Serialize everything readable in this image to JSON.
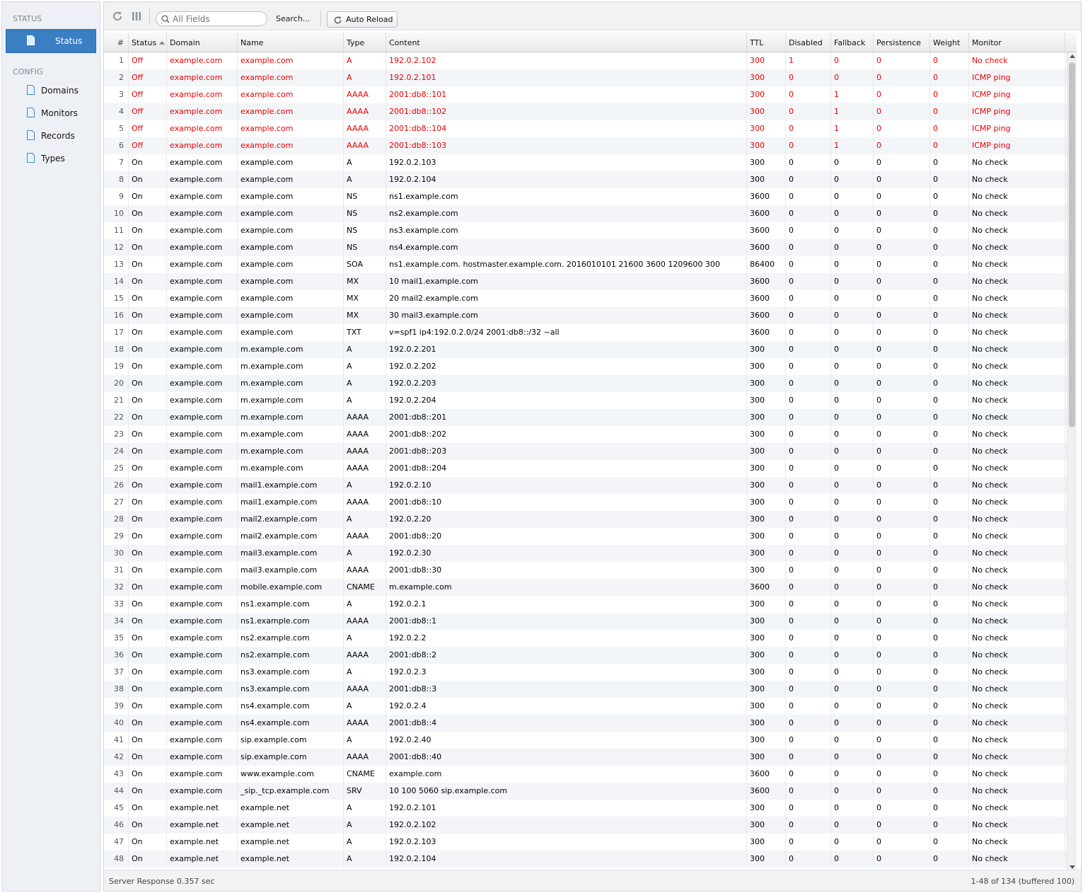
{
  "sidebar": {
    "status_section": "STATUS",
    "status_item": "Status",
    "config_section": "CONFIG",
    "config_items": [
      {
        "label": "Domains"
      },
      {
        "label": "Monitors"
      },
      {
        "label": "Records"
      },
      {
        "label": "Types"
      }
    ]
  },
  "toolbar": {
    "search_placeholder": "All Fields",
    "search_button": "Search...",
    "auto_reload": "Auto Reload"
  },
  "grid": {
    "columns": [
      "#",
      "Status",
      "Domain",
      "Name",
      "Type",
      "Content",
      "TTL",
      "Disabled",
      "Fallback",
      "Persistence",
      "Weight",
      "Monitor"
    ],
    "rows": [
      [
        "1",
        "Off",
        "example.com",
        "example.com",
        "A",
        "192.0.2.102",
        "300",
        "1",
        "0",
        "0",
        "0",
        "No check"
      ],
      [
        "2",
        "Off",
        "example.com",
        "example.com",
        "A",
        "192.0.2.101",
        "300",
        "0",
        "0",
        "0",
        "0",
        "ICMP ping"
      ],
      [
        "3",
        "Off",
        "example.com",
        "example.com",
        "AAAA",
        "2001:db8::101",
        "300",
        "0",
        "1",
        "0",
        "0",
        "ICMP ping"
      ],
      [
        "4",
        "Off",
        "example.com",
        "example.com",
        "AAAA",
        "2001:db8::102",
        "300",
        "0",
        "1",
        "0",
        "0",
        "ICMP ping"
      ],
      [
        "5",
        "Off",
        "example.com",
        "example.com",
        "AAAA",
        "2001:db8::104",
        "300",
        "0",
        "1",
        "0",
        "0",
        "ICMP ping"
      ],
      [
        "6",
        "Off",
        "example.com",
        "example.com",
        "AAAA",
        "2001:db8::103",
        "300",
        "0",
        "1",
        "0",
        "0",
        "ICMP ping"
      ],
      [
        "7",
        "On",
        "example.com",
        "example.com",
        "A",
        "192.0.2.103",
        "300",
        "0",
        "0",
        "0",
        "0",
        "No check"
      ],
      [
        "8",
        "On",
        "example.com",
        "example.com",
        "A",
        "192.0.2.104",
        "300",
        "0",
        "0",
        "0",
        "0",
        "No check"
      ],
      [
        "9",
        "On",
        "example.com",
        "example.com",
        "NS",
        "ns1.example.com",
        "3600",
        "0",
        "0",
        "0",
        "0",
        "No check"
      ],
      [
        "10",
        "On",
        "example.com",
        "example.com",
        "NS",
        "ns2.example.com",
        "3600",
        "0",
        "0",
        "0",
        "0",
        "No check"
      ],
      [
        "11",
        "On",
        "example.com",
        "example.com",
        "NS",
        "ns3.example.com",
        "3600",
        "0",
        "0",
        "0",
        "0",
        "No check"
      ],
      [
        "12",
        "On",
        "example.com",
        "example.com",
        "NS",
        "ns4.example.com",
        "3600",
        "0",
        "0",
        "0",
        "0",
        "No check"
      ],
      [
        "13",
        "On",
        "example.com",
        "example.com",
        "SOA",
        "ns1.example.com. hostmaster.example.com. 2016010101 21600 3600 1209600 300",
        "86400",
        "0",
        "0",
        "0",
        "0",
        "No check"
      ],
      [
        "14",
        "On",
        "example.com",
        "example.com",
        "MX",
        "10 mail1.example.com",
        "3600",
        "0",
        "0",
        "0",
        "0",
        "No check"
      ],
      [
        "15",
        "On",
        "example.com",
        "example.com",
        "MX",
        "20 mail2.example.com",
        "3600",
        "0",
        "0",
        "0",
        "0",
        "No check"
      ],
      [
        "16",
        "On",
        "example.com",
        "example.com",
        "MX",
        "30 mail3.example.com",
        "3600",
        "0",
        "0",
        "0",
        "0",
        "No check"
      ],
      [
        "17",
        "On",
        "example.com",
        "example.com",
        "TXT",
        "v=spf1 ip4:192.0.2.0/24 2001:db8::/32 ~all",
        "3600",
        "0",
        "0",
        "0",
        "0",
        "No check"
      ],
      [
        "18",
        "On",
        "example.com",
        "m.example.com",
        "A",
        "192.0.2.201",
        "300",
        "0",
        "0",
        "0",
        "0",
        "No check"
      ],
      [
        "19",
        "On",
        "example.com",
        "m.example.com",
        "A",
        "192.0.2.202",
        "300",
        "0",
        "0",
        "0",
        "0",
        "No check"
      ],
      [
        "20",
        "On",
        "example.com",
        "m.example.com",
        "A",
        "192.0.2.203",
        "300",
        "0",
        "0",
        "0",
        "0",
        "No check"
      ],
      [
        "21",
        "On",
        "example.com",
        "m.example.com",
        "A",
        "192.0.2.204",
        "300",
        "0",
        "0",
        "0",
        "0",
        "No check"
      ],
      [
        "22",
        "On",
        "example.com",
        "m.example.com",
        "AAAA",
        "2001:db8::201",
        "300",
        "0",
        "0",
        "0",
        "0",
        "No check"
      ],
      [
        "23",
        "On",
        "example.com",
        "m.example.com",
        "AAAA",
        "2001:db8::202",
        "300",
        "0",
        "0",
        "0",
        "0",
        "No check"
      ],
      [
        "24",
        "On",
        "example.com",
        "m.example.com",
        "AAAA",
        "2001:db8::203",
        "300",
        "0",
        "0",
        "0",
        "0",
        "No check"
      ],
      [
        "25",
        "On",
        "example.com",
        "m.example.com",
        "AAAA",
        "2001:db8::204",
        "300",
        "0",
        "0",
        "0",
        "0",
        "No check"
      ],
      [
        "26",
        "On",
        "example.com",
        "mail1.example.com",
        "A",
        "192.0.2.10",
        "300",
        "0",
        "0",
        "0",
        "0",
        "No check"
      ],
      [
        "27",
        "On",
        "example.com",
        "mail1.example.com",
        "AAAA",
        "2001:db8::10",
        "300",
        "0",
        "0",
        "0",
        "0",
        "No check"
      ],
      [
        "28",
        "On",
        "example.com",
        "mail2.example.com",
        "A",
        "192.0.2.20",
        "300",
        "0",
        "0",
        "0",
        "0",
        "No check"
      ],
      [
        "29",
        "On",
        "example.com",
        "mail2.example.com",
        "AAAA",
        "2001:db8::20",
        "300",
        "0",
        "0",
        "0",
        "0",
        "No check"
      ],
      [
        "30",
        "On",
        "example.com",
        "mail3.example.com",
        "A",
        "192.0.2.30",
        "300",
        "0",
        "0",
        "0",
        "0",
        "No check"
      ],
      [
        "31",
        "On",
        "example.com",
        "mail3.example.com",
        "AAAA",
        "2001:db8::30",
        "300",
        "0",
        "0",
        "0",
        "0",
        "No check"
      ],
      [
        "32",
        "On",
        "example.com",
        "mobile.example.com",
        "CNAME",
        "m.example.com",
        "3600",
        "0",
        "0",
        "0",
        "0",
        "No check"
      ],
      [
        "33",
        "On",
        "example.com",
        "ns1.example.com",
        "A",
        "192.0.2.1",
        "300",
        "0",
        "0",
        "0",
        "0",
        "No check"
      ],
      [
        "34",
        "On",
        "example.com",
        "ns1.example.com",
        "AAAA",
        "2001:db8::1",
        "300",
        "0",
        "0",
        "0",
        "0",
        "No check"
      ],
      [
        "35",
        "On",
        "example.com",
        "ns2.example.com",
        "A",
        "192.0.2.2",
        "300",
        "0",
        "0",
        "0",
        "0",
        "No check"
      ],
      [
        "36",
        "On",
        "example.com",
        "ns2.example.com",
        "AAAA",
        "2001:db8::2",
        "300",
        "0",
        "0",
        "0",
        "0",
        "No check"
      ],
      [
        "37",
        "On",
        "example.com",
        "ns3.example.com",
        "A",
        "192.0.2.3",
        "300",
        "0",
        "0",
        "0",
        "0",
        "No check"
      ],
      [
        "38",
        "On",
        "example.com",
        "ns3.example.com",
        "AAAA",
        "2001:db8::3",
        "300",
        "0",
        "0",
        "0",
        "0",
        "No check"
      ],
      [
        "39",
        "On",
        "example.com",
        "ns4.example.com",
        "A",
        "192.0.2.4",
        "300",
        "0",
        "0",
        "0",
        "0",
        "No check"
      ],
      [
        "40",
        "On",
        "example.com",
        "ns4.example.com",
        "AAAA",
        "2001:db8::4",
        "300",
        "0",
        "0",
        "0",
        "0",
        "No check"
      ],
      [
        "41",
        "On",
        "example.com",
        "sip.example.com",
        "A",
        "192.0.2.40",
        "300",
        "0",
        "0",
        "0",
        "0",
        "No check"
      ],
      [
        "42",
        "On",
        "example.com",
        "sip.example.com",
        "AAAA",
        "2001:db8::40",
        "300",
        "0",
        "0",
        "0",
        "0",
        "No check"
      ],
      [
        "43",
        "On",
        "example.com",
        "www.example.com",
        "CNAME",
        "example.com",
        "3600",
        "0",
        "0",
        "0",
        "0",
        "No check"
      ],
      [
        "44",
        "On",
        "example.com",
        "_sip._tcp.example.com",
        "SRV",
        "10 100 5060 sip.example.com",
        "3600",
        "0",
        "0",
        "0",
        "0",
        "No check"
      ],
      [
        "45",
        "On",
        "example.net",
        "example.net",
        "A",
        "192.0.2.101",
        "300",
        "0",
        "0",
        "0",
        "0",
        "No check"
      ],
      [
        "46",
        "On",
        "example.net",
        "example.net",
        "A",
        "192.0.2.102",
        "300",
        "0",
        "0",
        "0",
        "0",
        "No check"
      ],
      [
        "47",
        "On",
        "example.net",
        "example.net",
        "A",
        "192.0.2.103",
        "300",
        "0",
        "0",
        "0",
        "0",
        "No check"
      ],
      [
        "48",
        "On",
        "example.net",
        "example.net",
        "A",
        "192.0.2.104",
        "300",
        "0",
        "0",
        "0",
        "0",
        "No check"
      ]
    ]
  },
  "footer": {
    "response": "Server Response 0.357 sec",
    "paging": "1-48 of 134 (buffered 100)"
  },
  "colors": {
    "accent": "#3a7ec4",
    "off_text": "#e80000",
    "sidebar_bg": "#edf1f5"
  },
  "icons": {
    "reload": "reload-icon",
    "columns": "columns-icon",
    "search": "search-icon",
    "document": "document-icon"
  }
}
